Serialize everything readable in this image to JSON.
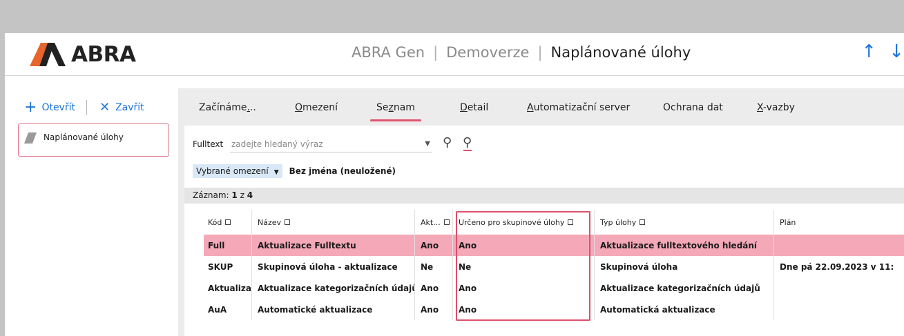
{
  "header": {
    "logo_text": "ABRA",
    "breadcrumb": [
      "ABRA Gen",
      "Demoverze"
    ],
    "title": "Naplánované úlohy",
    "arrow_up": "↑",
    "arrow_down": "↓"
  },
  "sidebar": {
    "open_label": "Otevřít",
    "close_label": "Zavřít",
    "item_label": "Naplánované úlohy"
  },
  "tabs": [
    {
      "pre": "Začínáme",
      "ul": ".",
      "post": ".."
    },
    {
      "pre": "",
      "ul": "O",
      "post": "mezení"
    },
    {
      "pre": "Se",
      "ul": "z",
      "post": "nam"
    },
    {
      "pre": "",
      "ul": "D",
      "post": "etail"
    },
    {
      "pre": "",
      "ul": "A",
      "post": "utomatizační server"
    },
    {
      "pre": "Ochrana dat",
      "ul": "",
      "post": ""
    },
    {
      "pre": "",
      "ul": "X",
      "post": "-vazby"
    }
  ],
  "search": {
    "label": "Fulltext",
    "placeholder": "zadejte hledaný výraz"
  },
  "filter": {
    "button_label": "Vybrané omezení",
    "name": "Bez jména (neuložené)"
  },
  "record": {
    "label": "Záznam:",
    "current": "1",
    "of": "z",
    "total": "4"
  },
  "table": {
    "columns": [
      "Kód",
      "Název",
      "Akt...",
      "Určeno pro skupinové úlohy",
      "Typ úlohy",
      "Plán"
    ],
    "rows": [
      [
        "Full",
        "Aktualizace Fulltextu",
        "Ano",
        "Ano",
        "Aktualizace fulltextového hledání",
        ""
      ],
      [
        "SKUP",
        "Skupinová úloha - aktualizace",
        "Ne",
        "Ne",
        "Skupinová úloha",
        "Dne pá 22.09.2023 v 11:"
      ],
      [
        "Aktualiza",
        "Aktualizace kategorizačních údajů",
        "Ano",
        "Ano",
        "Aktualizace kategorizačních údajů",
        ""
      ],
      [
        "AuA",
        "Automatické aktualizace",
        "Ano",
        "Ano",
        "Automatická aktualizace",
        ""
      ]
    ],
    "selected_row": 0
  },
  "colors": {
    "accent": "#e0536f",
    "link": "#1a73d8",
    "selected_row": "#f4a8b8",
    "highlight": "#de4f6c"
  }
}
